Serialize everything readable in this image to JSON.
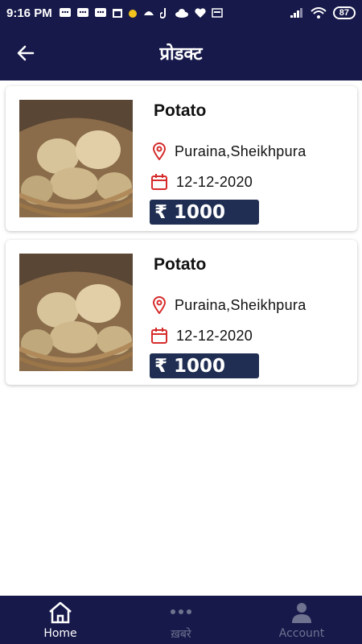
{
  "status_bar": {
    "time": "9:16 PM",
    "battery": "87",
    "icons": [
      "notification-icon",
      "message-icon",
      "message-icon",
      "calendar-icon",
      "app-icon",
      "app-icon",
      "tiktok-icon",
      "cloud-icon",
      "heart-icon",
      "news-icon"
    ],
    "right_icons": [
      "signal-icon",
      "wifi-icon",
      "battery-icon"
    ]
  },
  "app_bar": {
    "title": "प्रोडक्ट",
    "back_icon": "arrow-left-icon"
  },
  "products": [
    {
      "name": "Potato",
      "location": "Puraina,Sheikhpura",
      "date": "12-12-2020",
      "price": "₹ 1000",
      "image": "potato-basket-photo"
    },
    {
      "name": "Potato",
      "location": "Puraina,Sheikhpura",
      "date": "12-12-2020",
      "price": "₹ 1000",
      "image": "potato-basket-photo"
    }
  ],
  "bottom_nav": [
    {
      "label": "Home",
      "icon": "home-icon",
      "active": true
    },
    {
      "label": "ख़बरे",
      "icon": "more-dots-icon",
      "active": false
    },
    {
      "label": "Account",
      "icon": "person-icon",
      "active": false
    }
  ],
  "colors": {
    "primary": "#17194a",
    "price_bg": "#1f2e52",
    "icon_red": "#d62b2b",
    "nav_inactive": "#6f7390"
  }
}
